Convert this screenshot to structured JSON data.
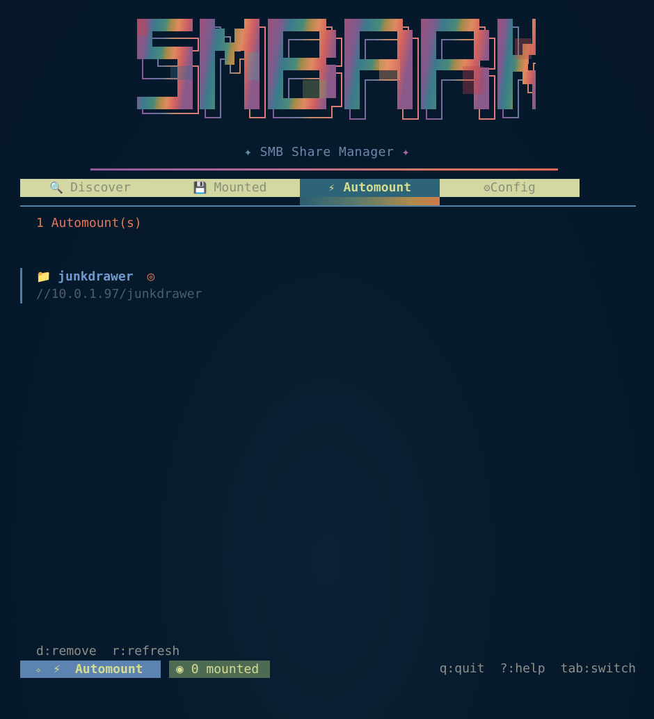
{
  "logo": {
    "text": "SMBARK"
  },
  "subtitle": {
    "star": "✦",
    "text": "SMB Share Manager"
  },
  "tabs": [
    {
      "icon": "🔍",
      "icon_name": "search-icon",
      "label": "Discover",
      "active": false
    },
    {
      "icon": "💾",
      "icon_name": "floppy-disk-icon",
      "label": "Mounted",
      "active": false
    },
    {
      "icon": "⚡",
      "icon_name": "lightning-icon",
      "label": "Automount",
      "active": true
    },
    {
      "icon": "⚙",
      "icon_name": "gear-icon",
      "label": "Config",
      "active": false
    }
  ],
  "main": {
    "count_label": "1 Automount(s)",
    "items": [
      {
        "icon": "📁",
        "name": "junkdrawer",
        "status_icon": "◎",
        "path": "//10.0.1.97/junkdrawer"
      }
    ]
  },
  "footer": {
    "hints": [
      "d:remove",
      "r:refresh"
    ],
    "mode": {
      "sparkle": "✧",
      "icon": "⚡",
      "label": "Automount"
    },
    "mounted": {
      "icon": "◉",
      "label": "0 mounted"
    },
    "keys": [
      "q:quit",
      "?:help",
      "tab:switch"
    ]
  },
  "colors": {
    "background": "#061a2e",
    "accent_orange": "#e0785c",
    "tab_bg": "#d3d8a3",
    "tab_active_bg": "#2e6478",
    "mode_bg": "#5d84b0",
    "mounted_bg": "#4d6a52"
  }
}
